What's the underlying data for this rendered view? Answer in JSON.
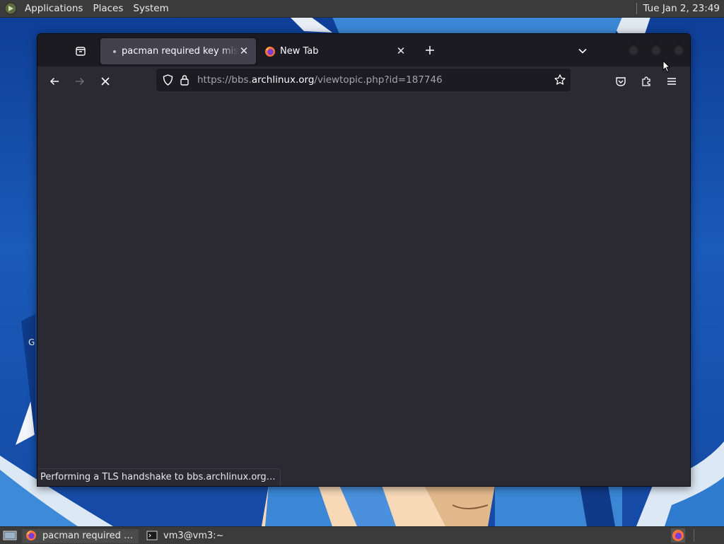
{
  "top_panel": {
    "menus": [
      "Applications",
      "Places",
      "System"
    ],
    "clock": "Tue Jan  2, 23:49"
  },
  "browser": {
    "tabs": [
      {
        "title": "pacman required key missing",
        "active": true,
        "loading": true
      },
      {
        "title": "New Tab",
        "active": false
      }
    ],
    "url": {
      "prefix": "https://bbs.",
      "host": "archlinux.org",
      "path": "/viewtopic.php?id=187746"
    },
    "status_text": "Performing a TLS handshake to bbs.archlinux.org…"
  },
  "desktop": {
    "partial_icon_label": "G"
  },
  "taskbar": {
    "tasks": [
      {
        "label": "pacman required ke…",
        "icon": "firefox-icon",
        "active": true
      },
      {
        "label": "vm3@vm3:~",
        "icon": "terminal-icon",
        "active": false
      }
    ]
  },
  "colors": {
    "accent_firefox": "#ff7139",
    "wallpaper_blue": "#1a5ab8"
  }
}
